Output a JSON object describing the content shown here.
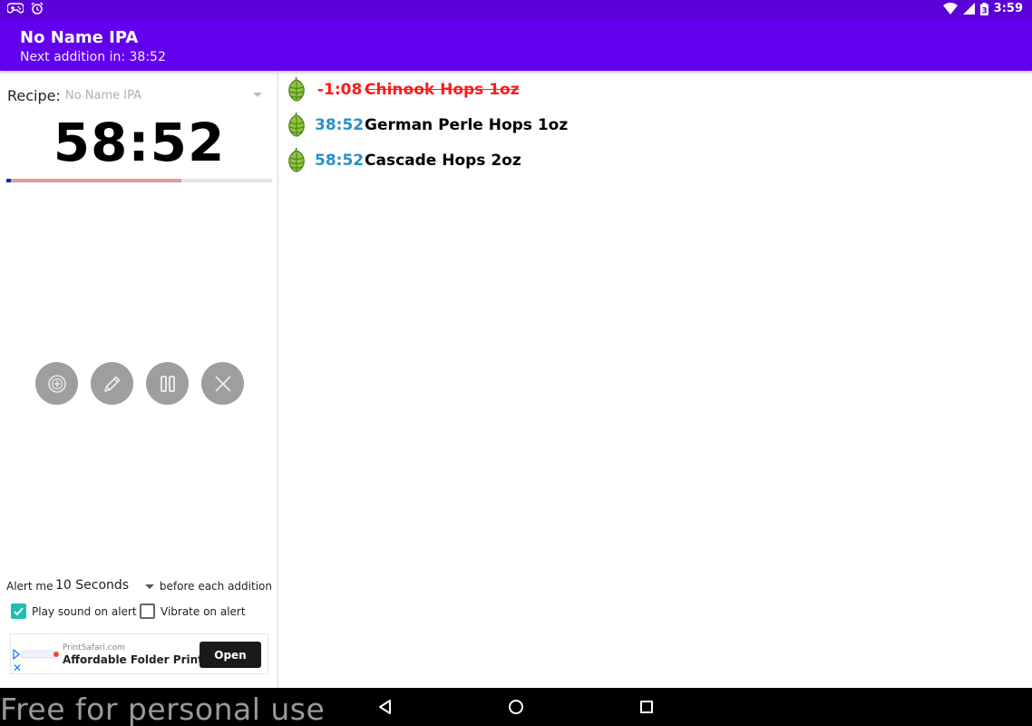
{
  "status_bar": {
    "time": "3:59",
    "battery_level": "3",
    "icons": [
      "game-controller-icon",
      "alarm-icon",
      "wifi-icon",
      "signal-icon",
      "battery-icon"
    ]
  },
  "app_bar": {
    "title": "No Name IPA",
    "subtitle": "Next addition in: 38:52",
    "color": "#6200ee"
  },
  "timer_panel": {
    "recipe_label": "Recipe:",
    "recipe_value": "No Name IPA",
    "timer": "58:52",
    "progress_fraction": 0.66,
    "controls": [
      "add-icon",
      "edit-pencil-icon",
      "pause-icon",
      "close-icon"
    ]
  },
  "alert_settings": {
    "label": "Alert me",
    "interval": "10 Seconds",
    "suffix": "before each addition",
    "play_sound_label": "Play sound on alert",
    "play_sound_checked": true,
    "vibrate_label": "Vibrate on alert",
    "vibrate_checked": false
  },
  "ad": {
    "domain": "PrintSafari.com",
    "headline": "Affordable Folder Printing",
    "cta": "Open",
    "close_glyph": "✕"
  },
  "additions": [
    {
      "time": "-1:08",
      "name": "Chinook Hops 1oz",
      "done": true
    },
    {
      "time": "38:52",
      "name": "German Perle Hops 1oz",
      "done": false
    },
    {
      "time": "58:52",
      "name": "Cascade Hops 2oz",
      "done": false
    }
  ],
  "nav_bar": {
    "watermark": "Free for personal use",
    "buttons": [
      "back-icon",
      "home-icon",
      "recents-icon"
    ]
  },
  "colors": {
    "done": "#ff1a1a",
    "upcoming": "#2a90c8",
    "checkbox": "#1fbfb0",
    "hop_green": "#8cc63f"
  }
}
